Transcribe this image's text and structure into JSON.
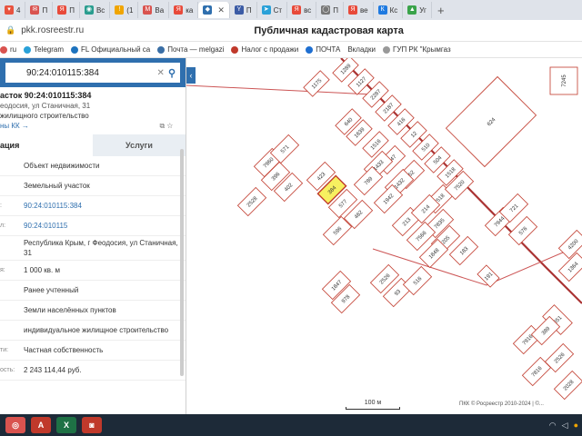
{
  "browser": {
    "tabs": [
      {
        "label": "4",
        "color": "#e8533f",
        "glyph": "▾"
      },
      {
        "label": "П",
        "color": "#d9534f",
        "glyph": "✉"
      },
      {
        "label": "П",
        "color": "#e84a3a",
        "glyph": "Я"
      },
      {
        "label": "Вс",
        "color": "#2a9d8f",
        "glyph": "◉"
      },
      {
        "label": "(1",
        "color": "#f0a500",
        "glyph": "!"
      },
      {
        "label": "Ва",
        "color": "#d9534f",
        "glyph": "М"
      },
      {
        "label": "ка",
        "color": "#e84a3a",
        "glyph": "Я"
      },
      {
        "label": "",
        "color": "#2f6fae",
        "glyph": "◆"
      },
      {
        "label": "П",
        "color": "#3b5ba5",
        "glyph": "Y"
      },
      {
        "label": "Ст",
        "color": "#2aa1d8",
        "glyph": "➤"
      },
      {
        "label": "вс",
        "color": "#e84a3a",
        "glyph": "Я"
      },
      {
        "label": "П",
        "color": "#777",
        "glyph": "◯"
      },
      {
        "label": "ве",
        "color": "#e84a3a",
        "glyph": "Я"
      },
      {
        "label": "Кс",
        "color": "#1f7ae0",
        "glyph": "К"
      },
      {
        "label": "Уг",
        "color": "#3aa34a",
        "glyph": "▲"
      }
    ],
    "new_tab": "+",
    "url": "pkk.rosreestr.ru",
    "page_title": "Публичная кадастровая карта"
  },
  "bookmarks": [
    {
      "label": "ru",
      "color": "#d9534f"
    },
    {
      "label": "Telegram",
      "color": "#2aa1d8"
    },
    {
      "label": "FL Официальный са",
      "color": "#1e73be"
    },
    {
      "label": "Почта — melgazi",
      "color": "#3a6ea5"
    },
    {
      "label": "Налог с продажи",
      "color": "#c0392b"
    },
    {
      "label": "ПОЧТА",
      "color": "#1f6fd1"
    },
    {
      "label": "Вкладки",
      "color": ""
    },
    {
      "label": "ГУП РК \"Крымгаз",
      "color": "#999"
    }
  ],
  "search": {
    "query": "90:24:010115:384",
    "clear": "✕",
    "button": "🔍"
  },
  "parcel": {
    "title": "асток 90:24:010115:384",
    "address_short": "еодосия, ул Станичная, 31",
    "use": "жилищного строительство",
    "link": "ны КК →"
  },
  "panel_tabs": {
    "info": "ация",
    "services": "Услуги"
  },
  "rows": [
    {
      "k": "",
      "v": "Объект недвижимости",
      "link": false
    },
    {
      "k": "",
      "v": "Земельный участок",
      "link": false
    },
    {
      "k": ":",
      "v": "90:24:010115:384",
      "link": true
    },
    {
      "k": "л:",
      "v": "90:24:010115",
      "link": true
    },
    {
      "k": "",
      "v": "Республика Крым, г Феодосия, ул Станичная, 31",
      "link": false
    },
    {
      "k": "я:",
      "v": "1 000 кв. м",
      "link": false
    },
    {
      "k": "",
      "v": "Ранее учтенный",
      "link": false
    },
    {
      "k": "",
      "v": "Земли населённых пунктов",
      "link": false
    },
    {
      "k": "",
      "v": "индивидуальное жилищное строительство",
      "link": false
    },
    {
      "k": "ти:",
      "v": "Частная собственность",
      "link": false
    },
    {
      "k": "ость:",
      "v": "2 243 114,44 руб.",
      "link": false
    }
  ],
  "map": {
    "scale_label": "100 м",
    "credit": "ПКК © Росреестр 2010-2024 | ©...",
    "highlight_label": "384",
    "parcel_labels": [
      "1175",
      "1289",
      "1127",
      "2287",
      "2187",
      "416",
      "12",
      "510",
      "504",
      "1518",
      "640",
      "1639",
      "1516",
      "1447",
      "452",
      "1433",
      "1432",
      "7518",
      "624",
      "7245",
      "7960",
      "571",
      "396",
      "402",
      "423",
      "384",
      "577",
      "462",
      "596",
      "789",
      "1942",
      "7520",
      "2528",
      "213",
      "214",
      "7835",
      "7566",
      "205",
      "183",
      "1848",
      "191",
      "7944",
      "721",
      "576",
      "1364",
      "651",
      "1847",
      "978",
      "2526",
      "93",
      "516",
      "7916",
      "389",
      "2526",
      "7816",
      "2028",
      "4200"
    ]
  },
  "taskbar": {
    "apps": [
      {
        "glyph": "◎",
        "color": "#d9534f"
      },
      {
        "glyph": "A",
        "color": "#c0392b"
      },
      {
        "glyph": "X",
        "color": "#1e7145"
      },
      {
        "glyph": "◙",
        "color": "#c0392b"
      }
    ]
  }
}
